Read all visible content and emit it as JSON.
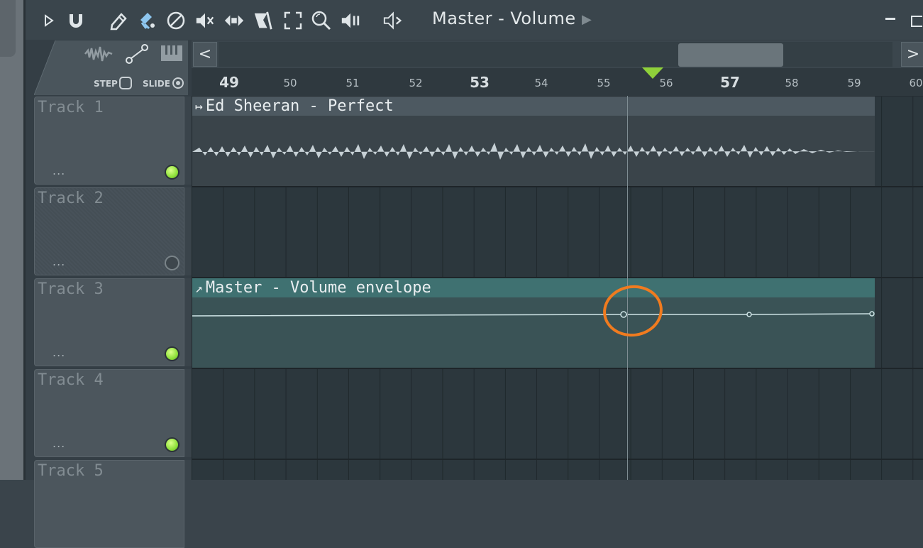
{
  "toolbar": {
    "title": "Master - Volume",
    "icons": [
      "play-triangle-icon",
      "magnet-icon",
      "pencil-icon",
      "paint-brush-icon",
      "delete-circle-icon",
      "mute-icon",
      "slip-icon",
      "slice-icon",
      "select-icon",
      "zoom-icon",
      "playback-icon",
      "speaker-icon"
    ]
  },
  "corner_panel": {
    "step_label": "STEP",
    "slide_label": "SLIDE"
  },
  "scrollbar": {
    "left_arrow": "<",
    "right_arrow": ">"
  },
  "ruler": {
    "bars": [
      "49",
      "50",
      "51",
      "52",
      "53",
      "54",
      "55",
      "56",
      "57",
      "58",
      "59",
      "60"
    ],
    "major_bars": [
      "49",
      "53",
      "57"
    ]
  },
  "tracks": [
    {
      "name": "Track 1",
      "dots": "...",
      "enabled": true
    },
    {
      "name": "Track 2",
      "dots": "...",
      "enabled": false
    },
    {
      "name": "Track 3",
      "dots": "...",
      "enabled": true
    },
    {
      "name": "Track 4",
      "dots": "...",
      "enabled": true
    },
    {
      "name": "Track 5",
      "dots": "...",
      "enabled": true
    }
  ],
  "clips": {
    "audio": {
      "title": "Ed Sheeran - Perfect",
      "icon": "audio-clip-icon"
    },
    "envelope": {
      "title": "Master - Volume envelope",
      "icon": "automation-icon"
    }
  },
  "colors": {
    "accent_green": "#8ee13a",
    "annotation_orange": "#f07b1f",
    "envelope_teal": "#3f7171"
  }
}
